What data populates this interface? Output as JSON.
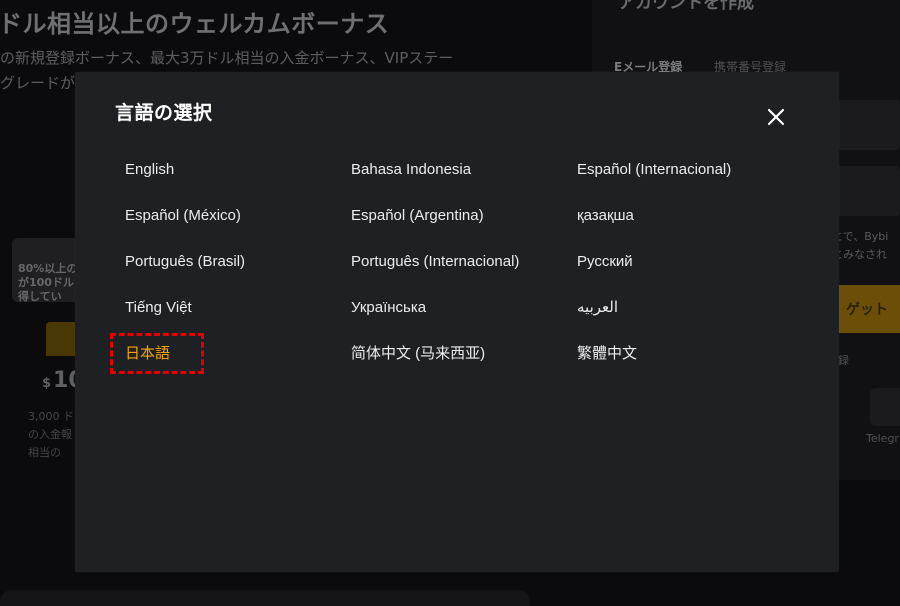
{
  "background": {
    "headline": "ドル相当以上のウェルカムボーナス",
    "subtext_lines": [
      "の新規登録ボーナス、最大3万ドル相当の入金ボーナス、VIPステー",
      "グレードが"
    ],
    "promo_card_text": "80%以上の\nが100ドル\n得してい",
    "amount_symbol": "$",
    "amount": "10",
    "small_lines": [
      "3,000 ド",
      "の入金報",
      "相当の"
    ],
    "right_panel": {
      "title": "アカウントを作成",
      "tab_email": "Eメール登録",
      "tab_phone": "携帯番号登録",
      "terms_lines": [
        "とで、Bybi",
        "とみなされ"
      ],
      "submit_label": "ゲット",
      "or_label": "録",
      "telegram_label": "Telegr"
    }
  },
  "modal": {
    "title": "言語の選択",
    "close_icon": "close-icon",
    "selected_color": "#f7a600",
    "text_color": "#eaecef",
    "languages": [
      {
        "id": "english",
        "label": "English"
      },
      {
        "id": "bahasa-indonesia",
        "label": "Bahasa Indonesia"
      },
      {
        "id": "espanol-internacional",
        "label": "Español (Internacional)"
      },
      {
        "id": "espanol-mexico",
        "label": "Español (México)"
      },
      {
        "id": "espanol-argentina",
        "label": "Español (Argentina)"
      },
      {
        "id": "kazakh",
        "label": "қазақша"
      },
      {
        "id": "portugues-brasil",
        "label": "Português (Brasil)"
      },
      {
        "id": "portugues-internacional",
        "label": "Português (Internacional)"
      },
      {
        "id": "russian",
        "label": "Русский"
      },
      {
        "id": "vietnamese",
        "label": "Tiếng Việt"
      },
      {
        "id": "ukrainian",
        "label": "Українська"
      },
      {
        "id": "arabic",
        "label": "العربيه"
      },
      {
        "id": "japanese",
        "label": "日本語",
        "selected": true
      },
      {
        "id": "chinese-simplified-malaysia",
        "label": "简体中文 (马来西亚)"
      },
      {
        "id": "chinese-traditional",
        "label": "繁體中文"
      }
    ]
  }
}
